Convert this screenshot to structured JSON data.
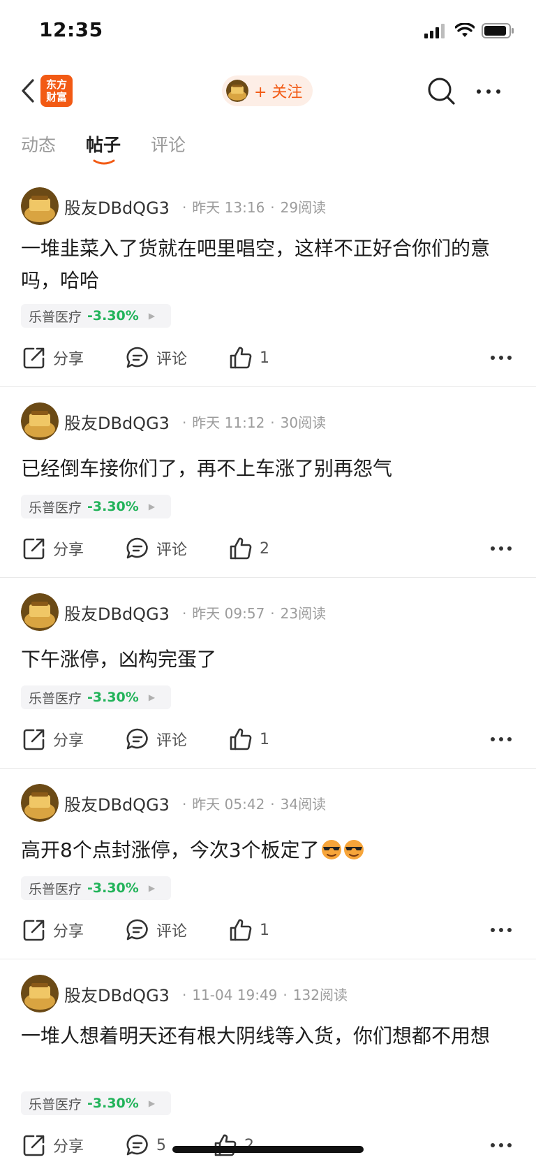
{
  "status_bar": {
    "time": "12:35"
  },
  "nav": {
    "logo_line1": "东方",
    "logo_line2": "财富",
    "follow_label": "+ 关注",
    "accent_color": "#f25a14"
  },
  "tabs": [
    {
      "label": "动态",
      "active": false
    },
    {
      "label": "帖子",
      "active": true
    },
    {
      "label": "评论",
      "active": false
    }
  ],
  "posts": [
    {
      "author": "股友DBdQG3",
      "time": "昨天 13:16",
      "reads": "29阅读",
      "text": "一堆韭菜入了货就在吧里唱空，这样不正好合你们的意吗，哈哈",
      "stock_name": "乐普医疗",
      "stock_change": "-3.30%",
      "share_label": "分享",
      "comment_label": "评论",
      "like_count": "1"
    },
    {
      "author": "股友DBdQG3",
      "time": "昨天 11:12",
      "reads": "30阅读",
      "text": "已经倒车接你们了，再不上车涨了别再怨气",
      "stock_name": "乐普医疗",
      "stock_change": "-3.30%",
      "share_label": "分享",
      "comment_label": "评论",
      "like_count": "2"
    },
    {
      "author": "股友DBdQG3",
      "time": "昨天 09:57",
      "reads": "23阅读",
      "text": "下午涨停，凶构完蛋了",
      "stock_name": "乐普医疗",
      "stock_change": "-3.30%",
      "share_label": "分享",
      "comment_label": "评论",
      "like_count": "1"
    },
    {
      "author": "股友DBdQG3",
      "time": "昨天 05:42",
      "reads": "34阅读",
      "text": "高开8个点封涨停，今次3个板定了",
      "emojis": [
        "sunglasses-emoji",
        "sunglasses-emoji"
      ],
      "stock_name": "乐普医疗",
      "stock_change": "-3.30%",
      "share_label": "分享",
      "comment_label": "评论",
      "like_count": "1"
    },
    {
      "author": "股友DBdQG3",
      "time": "11-04 19:49",
      "reads": "132阅读",
      "text": "一堆人想着明天还有根大阴线等入货，你们想都不用想",
      "stock_name": "乐普医疗",
      "stock_change": "-3.30%",
      "share_label": "分享",
      "comment_label": "5",
      "like_count": "2"
    }
  ]
}
